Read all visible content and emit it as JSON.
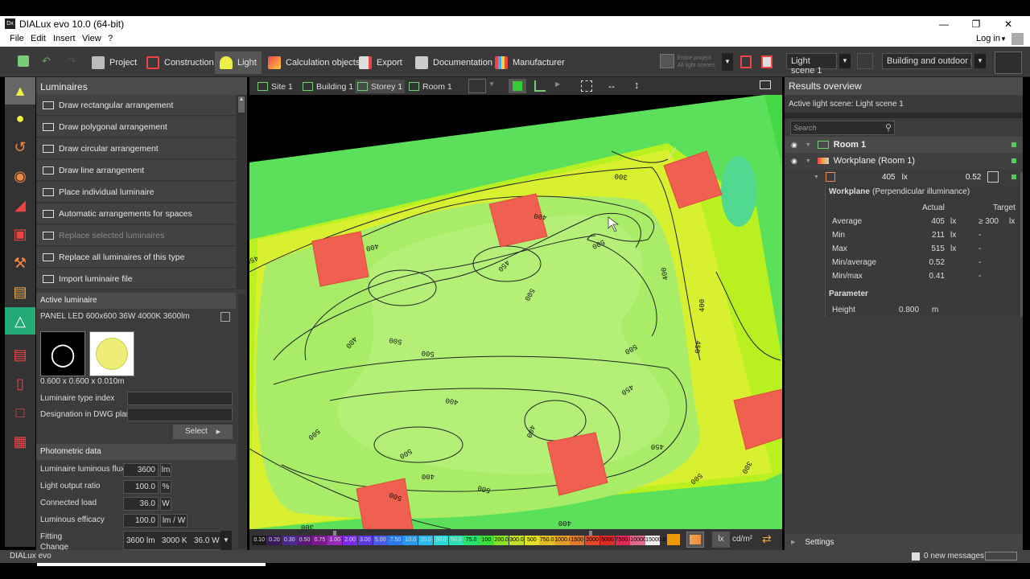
{
  "window": {
    "logo": "Dx",
    "title": "DIALux evo 10.0  (64-bit)"
  },
  "menu": {
    "items": [
      "File",
      "Edit",
      "Insert",
      "View",
      "?"
    ],
    "login": "Log in"
  },
  "toolbar": {
    "tabs": [
      {
        "label": "Project",
        "icon": "project-icon"
      },
      {
        "label": "Construction",
        "icon": "construction-icon"
      },
      {
        "label": "Light",
        "icon": "light-icon"
      },
      {
        "label": "Calculation objects",
        "icon": "calculation-objects-icon"
      },
      {
        "label": "Export",
        "icon": "export-icon"
      },
      {
        "label": "Documentation",
        "icon": "documentation-icon"
      },
      {
        "label": "Manufacturer",
        "icon": "manufacturer-icon"
      }
    ],
    "active_tab": "Light",
    "entire_project": "Entire project",
    "all_light_scenes": "All light scenes",
    "light_scene": "Light scene 1",
    "view_select": "Building and outdoor pla..."
  },
  "left_panel": {
    "title": "Luminaires",
    "items": [
      {
        "label": "Draw rectangular arrangement",
        "enabled": true
      },
      {
        "label": "Draw polygonal arrangement",
        "enabled": true
      },
      {
        "label": "Draw circular arrangement",
        "enabled": true
      },
      {
        "label": "Draw line arrangement",
        "enabled": true
      },
      {
        "label": "Place individual luminaire",
        "enabled": true
      },
      {
        "label": "Automatic arrangements for spaces",
        "enabled": true
      },
      {
        "label": "Replace selected luminaires",
        "enabled": false
      },
      {
        "label": "Replace all luminaires of this type",
        "enabled": true
      },
      {
        "label": "Import luminaire file",
        "enabled": true
      }
    ],
    "active_luminaire": {
      "header": "Active luminaire",
      "name": "PANEL LED 600x600 36W 4000K 3600lm",
      "dimensions": "0.600 x 0.600 x 0.010m",
      "type_index_label": "Luminaire type index",
      "dwg_label": "Designation in DWG plan",
      "select_label": "Select"
    },
    "photometric": {
      "header": "Photometric data",
      "rows": [
        {
          "label": "Luminaire luminous flux",
          "value": "3600",
          "unit": "lm"
        },
        {
          "label": "Light output ratio",
          "value": "100.0",
          "unit": "%"
        },
        {
          "label": "Connected load",
          "value": "36.0",
          "unit": "W"
        },
        {
          "label": "Luminous efficacy",
          "value": "100.0",
          "unit": "lm / W"
        }
      ],
      "fitting_label": "Fitting",
      "change_label": "Change",
      "fitting_value": "3600 lm   3000 K   36.0 W"
    }
  },
  "view_bar": {
    "breadcrumbs": [
      "Site 1",
      "Building 1",
      "Storey 1",
      "Room 1"
    ]
  },
  "contours": [
    "300",
    "400",
    "500",
    "400",
    "500",
    "400",
    "500",
    "500",
    "450",
    "500",
    "400",
    "500",
    "500",
    "400",
    "450",
    "450",
    "500",
    "400",
    "450",
    "300",
    "500",
    "500",
    "400",
    "400",
    "300",
    "450",
    "400"
  ],
  "scale": {
    "values": [
      "0.10",
      "0.20",
      "0.30",
      "0.50",
      "0.75",
      "1.00",
      "2.00",
      "3.00",
      "5.00",
      "7.50",
      "10.0",
      "20.0",
      "30.0",
      "50.0",
      "75.0",
      "100",
      "200.0",
      "300.0",
      "500",
      "750.0",
      "1000.0",
      "1500",
      "2000",
      "5000",
      "7500.0",
      "10000.0",
      "15000.0"
    ],
    "colors": [
      "#1a1a1a",
      "#3a1a5a",
      "#4a2a8a",
      "#5a1a7a",
      "#7a1a8a",
      "#9a2aba",
      "#7a2aea",
      "#5a3ae0",
      "#4a5aea",
      "#2a7aea",
      "#2a9aea",
      "#2abaea",
      "#2adada",
      "#2ae0b0",
      "#2ae070",
      "#3ae03a",
      "#8ae02a",
      "#c0e02a",
      "#e0e02a",
      "#e0c02a",
      "#e0a02a",
      "#e07a2a",
      "#e04a2a",
      "#e02a2a",
      "#e02a5a",
      "#e06a8a",
      "#f0f0f0"
    ],
    "units": [
      "lx",
      "cd/m²"
    ]
  },
  "right_panel": {
    "title": "Results overview",
    "active_scene": "Active light scene: Light scene 1",
    "search_placeholder": "Search",
    "tree": {
      "room": "Room 1",
      "workplane": "Workplane (Room 1)",
      "value": "405",
      "unit": "lx",
      "ratio": "0.52"
    },
    "workplane": {
      "title": "Workplane",
      "subtitle": "(Perpendicular illuminance)",
      "actual_label": "Actual",
      "target_label": "Target",
      "rows": [
        {
          "label": "Average",
          "actual": "405",
          "unit": "lx",
          "target": "≥  300",
          "tunit": "lx"
        },
        {
          "label": "Min",
          "actual": "211",
          "unit": "lx",
          "target": "-",
          "tunit": ""
        },
        {
          "label": "Max",
          "actual": "515",
          "unit": "lx",
          "target": "-",
          "tunit": ""
        },
        {
          "label": "Min/average",
          "actual": "0.52",
          "unit": "",
          "target": "-",
          "tunit": ""
        },
        {
          "label": "Min/max",
          "actual": "0.41",
          "unit": "",
          "target": "-",
          "tunit": ""
        }
      ],
      "param_title": "Parameter",
      "height_label": "Height",
      "height_value": "0.800",
      "height_unit": "m"
    },
    "settings": "Settings"
  },
  "status": {
    "app": "DIALux evo",
    "app_lux": "lux",
    "messages": "0 new messages"
  }
}
